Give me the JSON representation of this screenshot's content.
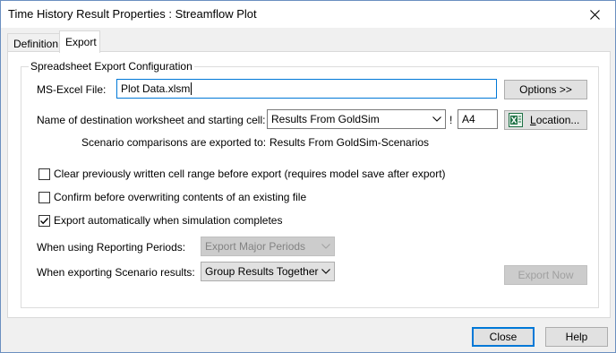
{
  "window": {
    "title": "Time History Result Properties : Streamflow Plot"
  },
  "tabs": [
    {
      "label": "Definition",
      "active": false
    },
    {
      "label": "Export",
      "active": true
    }
  ],
  "group": {
    "title": "Spreadsheet Export Configuration"
  },
  "excel_file": {
    "label": "MS-Excel File:",
    "value": "Plot Data.xlsm",
    "options_button": "Options >>"
  },
  "worksheet": {
    "label": "Name of destination worksheet and starting cell:",
    "value": "Results From GoldSim",
    "separator": "!",
    "cell": "A4",
    "location_button": "Location...",
    "location_button_mnemonic": "L",
    "location_button_rest": "ocation..."
  },
  "scenario": {
    "label": "Scenario comparisons are exported to:",
    "value": "Results From GoldSim-Scenarios"
  },
  "checkboxes": [
    {
      "label": "Clear previously written cell range before export (requires model save after export)",
      "checked": false
    },
    {
      "label": "Confirm before overwriting contents of an existing file",
      "checked": false
    },
    {
      "label": "Export automatically when simulation completes",
      "checked": true
    }
  ],
  "reporting_periods": {
    "label": "When using Reporting Periods:",
    "value": "Export Major Periods",
    "enabled": false
  },
  "scenario_results": {
    "label": "When exporting Scenario results:",
    "value": "Group Results Together"
  },
  "export_now_button": "Export Now",
  "footer": {
    "close_button": "Close",
    "help_button": "Help"
  },
  "colors": {
    "accent": "#0078d7",
    "excel_green": "#1e7145"
  }
}
